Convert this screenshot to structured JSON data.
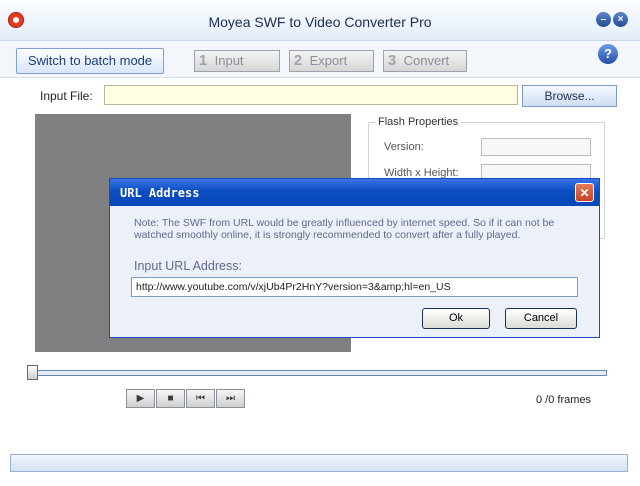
{
  "window": {
    "title": "Moyea SWF to Video Converter Pro"
  },
  "toolbar": {
    "batch_label": "Switch to batch mode",
    "steps": [
      {
        "num": "1",
        "label": "Input"
      },
      {
        "num": "2",
        "label": "Export"
      },
      {
        "num": "3",
        "label": "Convert"
      }
    ],
    "help_glyph": "?"
  },
  "input": {
    "label": "Input File:",
    "value": "",
    "browse_label": "Browse..."
  },
  "flash_properties": {
    "legend": "Flash Properties",
    "rows": [
      {
        "label": "Version:",
        "value": ""
      },
      {
        "label": "Width x Height:",
        "value": ""
      }
    ]
  },
  "player": {
    "frames_text": "0 /0 frames",
    "controls": [
      {
        "name": "play",
        "glyph": "▶"
      },
      {
        "name": "stop",
        "glyph": "■"
      },
      {
        "name": "rewind",
        "glyph": "⏮"
      },
      {
        "name": "forward",
        "glyph": "⏭"
      }
    ]
  },
  "dialog": {
    "title": "URL Address",
    "note": "Note: The SWF from URL would be greatly influenced by internet speed. So if it can not be watched smoothly online, it is strongly recommended to convert after a fully played.",
    "url_label": "Input URL Address:",
    "url_value": "http://www.youtube.com/v/xjUb4Pr2HnY?version=3&amp;hl=en_US",
    "ok_label": "Ok",
    "cancel_label": "Cancel"
  },
  "icons": {
    "app": "moyea-logo-icon",
    "minimize": "minimize-icon",
    "close": "close-icon",
    "help": "help-icon"
  },
  "colors": {
    "accent": "#0b4ec2",
    "input_bg": "#ffffe1",
    "preview_bg": "#808080"
  }
}
